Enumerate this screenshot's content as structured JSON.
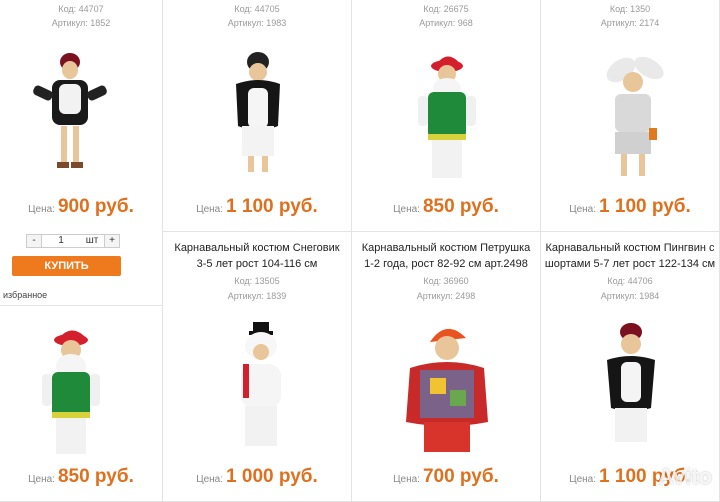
{
  "products": [
    {
      "code": "Код: 44707",
      "article": "Артикул: 1852",
      "price_label": "Цена:",
      "price": "900 руб."
    },
    {
      "code": "Код: 44705",
      "article": "Артикул: 1983",
      "price_label": "Цена:",
      "price": "1 100 руб."
    },
    {
      "code": "Код: 26675",
      "article": "Артикул: 968",
      "price_label": "Цена:",
      "price": "850 руб."
    },
    {
      "code": "Код: 1350",
      "article": "Артикул: 2174",
      "price_label": "Цена:",
      "price": "1 100 руб."
    },
    {
      "title": "",
      "code": "",
      "article": "",
      "price_label": "Цена:",
      "price": "850 руб."
    },
    {
      "title": "Карнавальный костюм Снеговик\n3-5 лет рост 104-116 см",
      "code": "Код: 13505",
      "article": "Артикул: 1839",
      "price_label": "Цена:",
      "price": "1 000 руб."
    },
    {
      "title": "Карнавальный костюм Петрушка\n1-2 года, рост 82-92 см арт.2498",
      "code": "Код: 36960",
      "article": "Артикул: 2498",
      "price_label": "Цена:",
      "price": "700 руб."
    },
    {
      "title": "Карнавальный костюм Пингвин с\nшортами 5-7 лет рост 122-134 см",
      "code": "Код: 44706",
      "article": "Артикул: 1984",
      "price_label": "Цена:",
      "price": "1 100 руб."
    }
  ],
  "cart": {
    "minus": "-",
    "qty": "1",
    "unit": "шт",
    "plus": "+",
    "buy": "КУПИТЬ",
    "favorite": "избранное"
  },
  "watermark": "Avito",
  "colors": {
    "price": "#e0701e",
    "button": "#ef7a1e"
  }
}
